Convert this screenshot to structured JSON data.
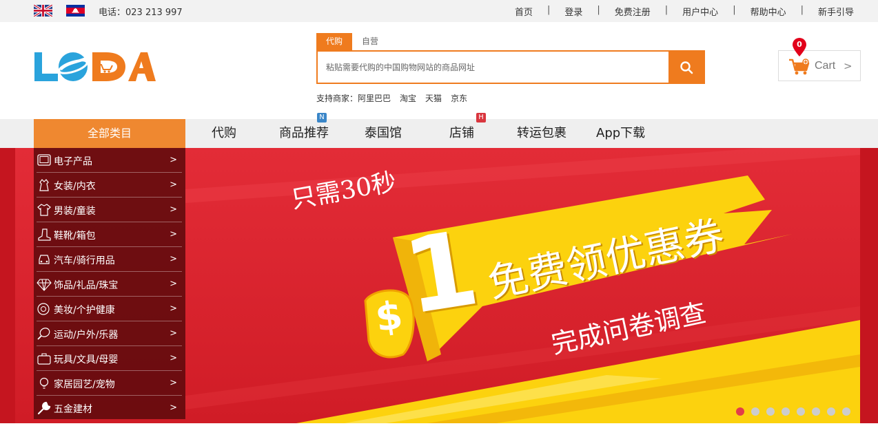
{
  "topbar": {
    "phone": "电话：023 213 997",
    "links": [
      "首页",
      "登录",
      "免费注册",
      "用户中心",
      "帮助中心",
      "新手引导"
    ],
    "separator": "|"
  },
  "logo": {
    "text": "LODA"
  },
  "search": {
    "tabs": [
      "代购",
      "自营"
    ],
    "placeholder": "粘贴需要代购的中国购物网站的商品网址",
    "merchants_label": "支持商家：",
    "merchants": [
      "阿里巴巴",
      "淘宝",
      "天猫",
      "京东"
    ]
  },
  "cart": {
    "label": "Cart",
    "count": "0",
    "chevron": ">"
  },
  "nav": {
    "all_categories": "全部类目",
    "items": [
      "代购",
      "商品推荐",
      "泰国馆",
      "店铺",
      "转运包裹",
      "App下载"
    ],
    "badge_new": "N",
    "badge_hot": "H"
  },
  "categories": [
    {
      "label": "电子产品",
      "icon": "tablet-icon"
    },
    {
      "label": "女装/内衣",
      "icon": "dress-icon"
    },
    {
      "label": "男装/童装",
      "icon": "tshirt-icon"
    },
    {
      "label": "鞋靴/箱包",
      "icon": "boot-icon"
    },
    {
      "label": "汽车/骑行用品",
      "icon": "car-icon"
    },
    {
      "label": "饰品/礼品/珠宝",
      "icon": "diamond-icon"
    },
    {
      "label": "美妆/个护健康",
      "icon": "makeup-icon"
    },
    {
      "label": "运动/户外/乐器",
      "icon": "racket-icon"
    },
    {
      "label": "玩具/文具/母婴",
      "icon": "toy-icon"
    },
    {
      "label": "家居园艺/宠物",
      "icon": "bulb-icon"
    },
    {
      "label": "五金建材",
      "icon": "wrench-icon"
    }
  ],
  "category_arrow": ">",
  "banner": {
    "line1": "只需30秒",
    "currency": "$",
    "amount": "1",
    "line2": "免费领优惠券",
    "line3": "完成问卷调查",
    "slide_count": 8,
    "active_slide": 1
  },
  "colors": {
    "accent": "#ef7b1e",
    "banner_red": "#d8202c",
    "banner_yellow": "#fcd20e",
    "badge_blue": "#3a86c8",
    "badge_red": "#d9363e"
  }
}
